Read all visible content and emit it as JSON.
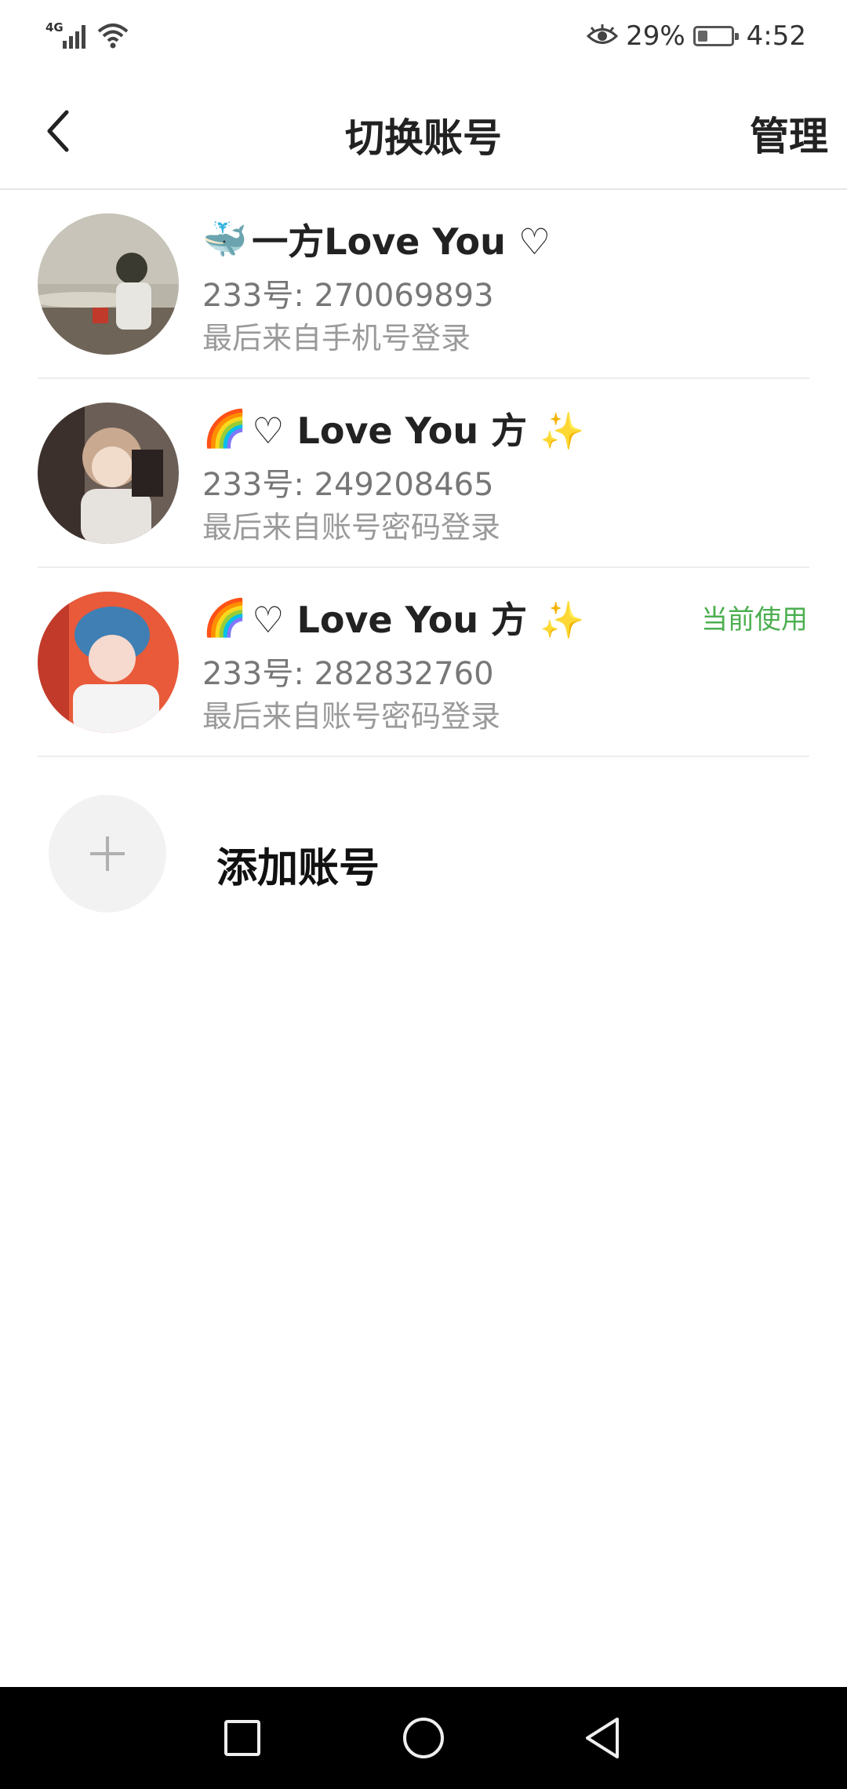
{
  "status_bar": {
    "network": "4G",
    "battery_percent": "29%",
    "battery_level": 0.29,
    "time": "4:52",
    "icons": [
      "signal-icon",
      "wifi-icon",
      "eye-comfort-icon",
      "battery-icon"
    ]
  },
  "header": {
    "title": "切换账号",
    "manage": "管理",
    "back_icon": "back-arrow-icon"
  },
  "accounts": [
    {
      "name_emoji": "🐳",
      "name_text": "一方Love You ♡",
      "uid": "233号: 270069893",
      "login": "最后来自手机号登录",
      "current": ""
    },
    {
      "name_emoji": "🌈",
      "name_text": "♡ Love You 方 ✨",
      "uid": "233号: 249208465",
      "login": "最后来自账号密码登录",
      "current": ""
    },
    {
      "name_emoji": "🌈",
      "name_text": "♡ Love You 方 ✨",
      "uid": "233号: 282832760",
      "login": "最后来自账号密码登录",
      "current": "当前使用"
    }
  ],
  "add_account": {
    "label": "添加账号",
    "icon": "plus-icon"
  },
  "nav_bar": {
    "icons": [
      "recent-apps-icon",
      "home-icon",
      "back-icon"
    ]
  },
  "colors": {
    "current_badge": "#4caf50",
    "nav_bg": "#000000",
    "divider": "#ececec"
  }
}
